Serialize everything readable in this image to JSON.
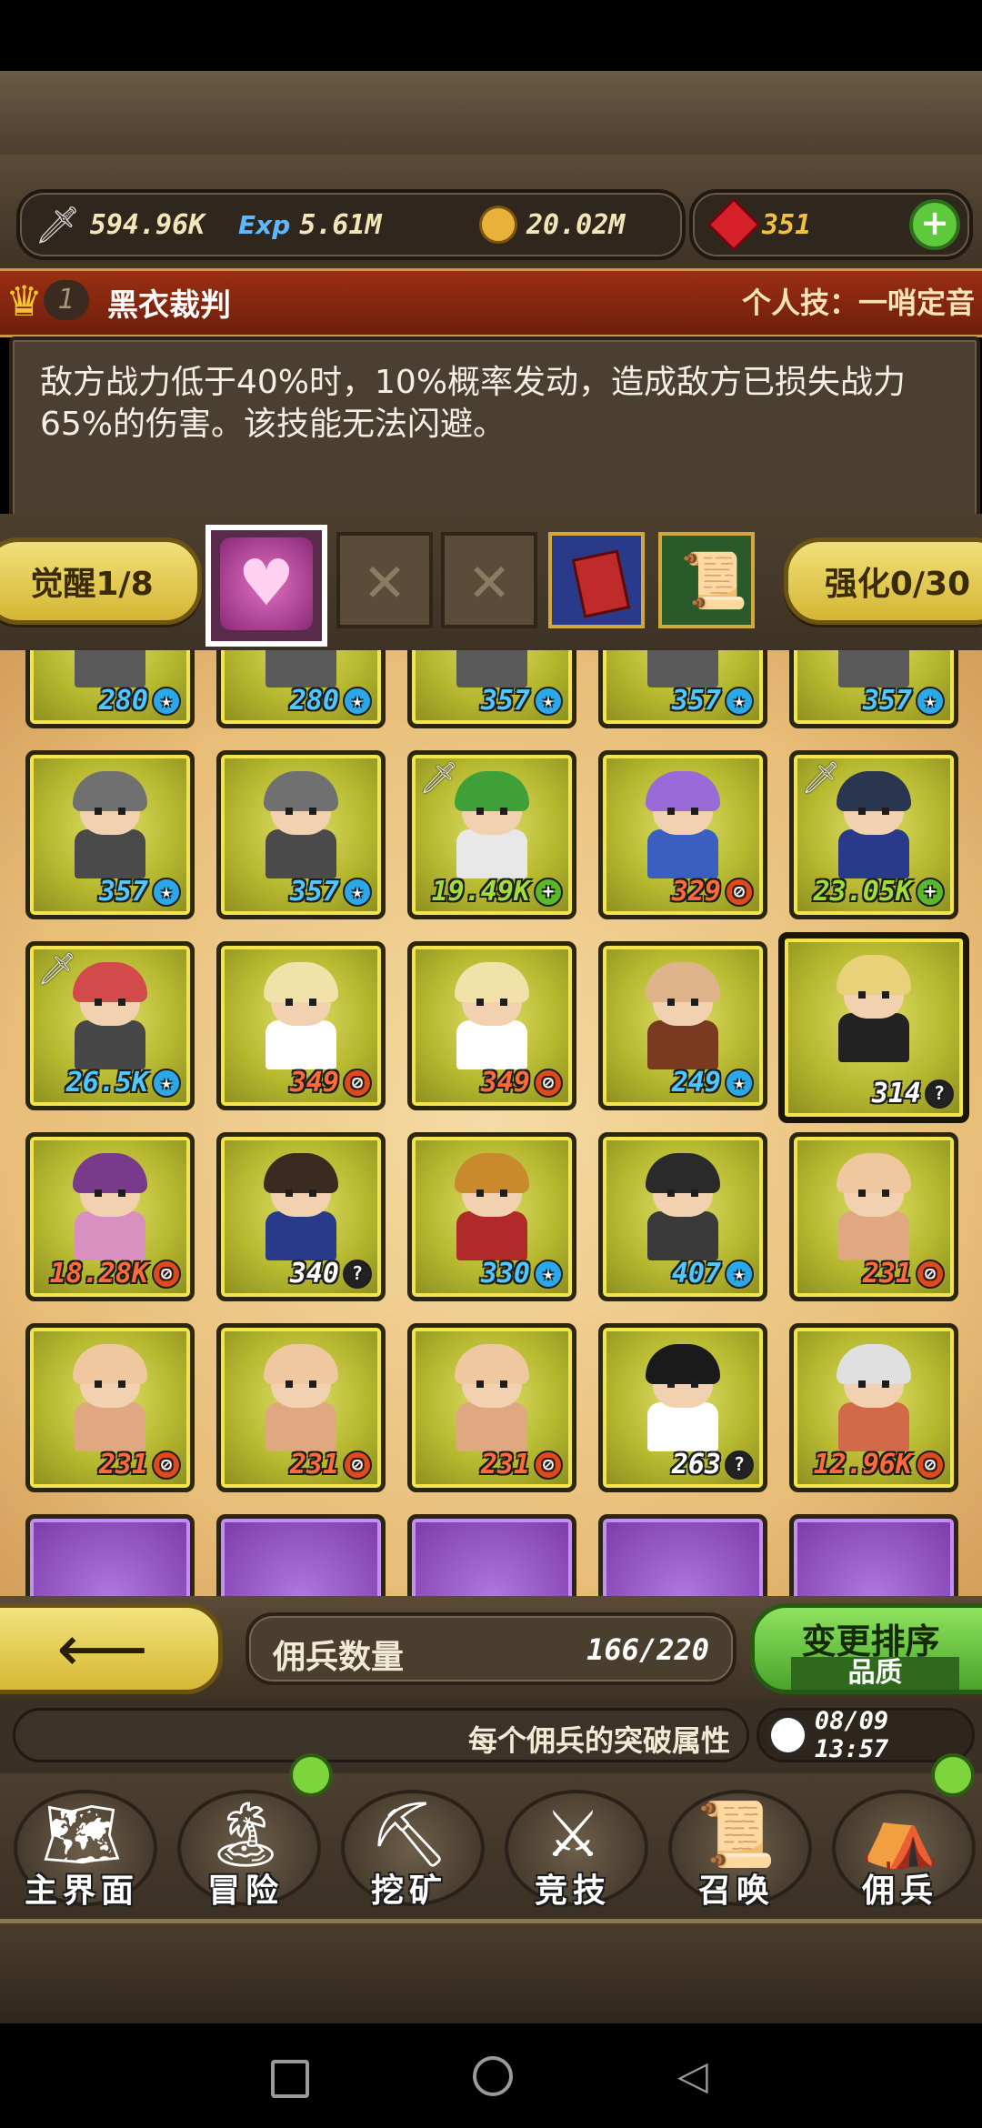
{
  "resources": {
    "attack": "594.96K",
    "exp": "5.61M",
    "gold": "20.02M",
    "gems": "351",
    "exp_label": "Exp"
  },
  "hero": {
    "rank": "1",
    "name": "黑衣裁判",
    "skill_title": "个人技：一哨定音",
    "skill_desc": "敌方战力低于40%时，10%概率发动，造成敌方已损失战力65%的伤害。该技能无法闪避。"
  },
  "tabs": {
    "awaken": "觉醒1/8",
    "enhance": "强化0/30"
  },
  "grid": {
    "rows": [
      [
        {
          "value": "280",
          "icon": "star",
          "color": "#4fc8ff",
          "hair": "#7b7b7b",
          "body": "#5a5a5a"
        },
        {
          "value": "280",
          "icon": "star",
          "color": "#4fc8ff",
          "hair": "#7b7b7b",
          "body": "#5a5a5a"
        },
        {
          "value": "357",
          "icon": "star",
          "color": "#4fc8ff",
          "hair": "#7b7b7b",
          "body": "#5a5a5a"
        },
        {
          "value": "357",
          "icon": "star",
          "color": "#4fc8ff",
          "hair": "#7b7b7b",
          "body": "#5a5a5a"
        },
        {
          "value": "357",
          "icon": "star",
          "color": "#4fc8ff",
          "hair": "#7b7b7b",
          "body": "#5a5a5a"
        }
      ],
      [
        {
          "value": "357",
          "icon": "star",
          "color": "#4fc8ff",
          "hair": "#707070",
          "body": "#4a4a4a"
        },
        {
          "value": "357",
          "icon": "star",
          "color": "#4fc8ff",
          "hair": "#707070",
          "body": "#4a4a4a"
        },
        {
          "value": "19.49K",
          "icon": "plus",
          "color": "#9fdc3c",
          "hair": "#3fa03a",
          "body": "#e8e8e8",
          "sword": true
        },
        {
          "value": "329",
          "icon": "no",
          "color": "#ff6a3a",
          "hair": "#9a6ad8",
          "body": "#3a5fc0"
        },
        {
          "value": "23.05K",
          "icon": "plus",
          "color": "#9fdc3c",
          "hair": "#2a3550",
          "body": "#2a3a8a",
          "sword": true
        }
      ],
      [
        {
          "value": "26.5K",
          "icon": "star",
          "color": "#4fc8ff",
          "hair": "#d24a4a",
          "body": "#474747",
          "sword": true
        },
        {
          "value": "349",
          "icon": "no",
          "color": "#ff6a3a",
          "hair": "#f0e2a8",
          "body": "#ffffff"
        },
        {
          "value": "349",
          "icon": "no",
          "color": "#ff6a3a",
          "hair": "#f0e2a8",
          "body": "#ffffff"
        },
        {
          "value": "249",
          "icon": "star",
          "color": "#4fc8ff",
          "hair": "#e0b48a",
          "body": "#7a3a20"
        },
        {
          "value": "314",
          "icon": "help",
          "color": "#ffffff",
          "hair": "#e7d27a",
          "body": "#222222",
          "selected": true
        }
      ],
      [
        {
          "value": "18.28K",
          "icon": "no",
          "color": "#ff6a3a",
          "hair": "#7a3a8c",
          "body": "#d890c0"
        },
        {
          "value": "340",
          "icon": "help",
          "color": "#ffffff",
          "hair": "#3a2a20",
          "body": "#2a3a8a"
        },
        {
          "value": "330",
          "icon": "star",
          "color": "#4fc8ff",
          "hair": "#c88a2a",
          "body": "#b02a2a"
        },
        {
          "value": "407",
          "icon": "star",
          "color": "#4fc8ff",
          "hair": "#2a2a2a",
          "body": "#3a3a3a"
        },
        {
          "value": "231",
          "icon": "no",
          "color": "#ff6a3a",
          "hair": "#f0c8a0",
          "body": "#e0a880"
        }
      ],
      [
        {
          "value": "231",
          "icon": "no",
          "color": "#ff6a3a",
          "hair": "#f0c8a0",
          "body": "#e0a880"
        },
        {
          "value": "231",
          "icon": "no",
          "color": "#ff6a3a",
          "hair": "#f0c8a0",
          "body": "#e0a880"
        },
        {
          "value": "231",
          "icon": "no",
          "color": "#ff6a3a",
          "hair": "#f0c8a0",
          "body": "#e0a880"
        },
        {
          "value": "263",
          "icon": "help",
          "color": "#ffffff",
          "hair": "#1a1a1a",
          "body": "#ffffff"
        },
        {
          "value": "12.96K",
          "icon": "no",
          "color": "#ff6a3a",
          "hair": "#e0e0e0",
          "body": "#d26a4a"
        }
      ]
    ]
  },
  "bottom": {
    "count_label": "佣兵数量",
    "count_value": "166/220",
    "sort_label": "变更排序",
    "sort_sub": "品质",
    "ticker": "每个佣兵的突破属性",
    "time": "08/09 13:57"
  },
  "nav": [
    {
      "label": "主界面",
      "icon": "map-scroll-icon",
      "glyph": "🗺"
    },
    {
      "label": "冒险",
      "icon": "island-icon",
      "glyph": "🏝"
    },
    {
      "label": "挖矿",
      "icon": "pickaxe-icon",
      "glyph": "⛏"
    },
    {
      "label": "竞技",
      "icon": "crossed-swords-icon",
      "glyph": "⚔"
    },
    {
      "label": "召唤",
      "icon": "summon-scroll-icon",
      "glyph": "📜"
    },
    {
      "label": "佣兵",
      "icon": "tent-icon",
      "glyph": "⛺"
    }
  ]
}
